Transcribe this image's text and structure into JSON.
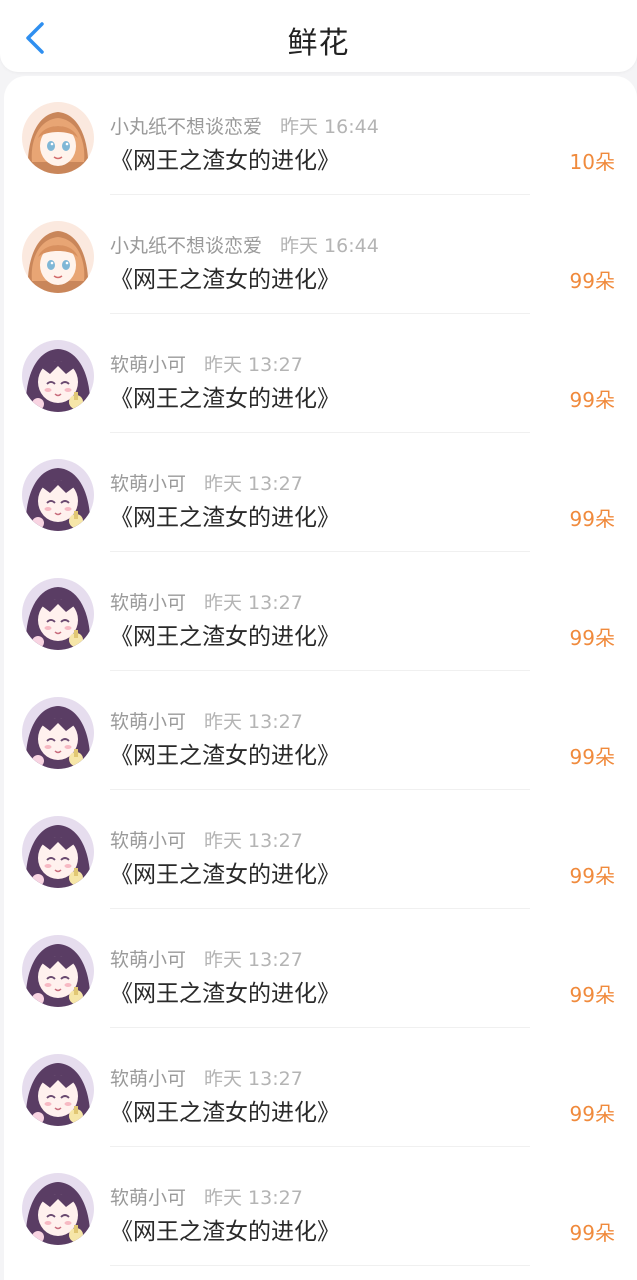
{
  "header": {
    "title": "鲜花",
    "back_icon": "chevron-left-icon",
    "accent_color": "#2f8ff0"
  },
  "colors": {
    "amount": "#f08a3c"
  },
  "items": [
    {
      "avatar": "avatar-girl-orange",
      "name": "小丸纸不想谈恋爱",
      "time": "昨天 16:44",
      "book": "《网王之渣女的进化》",
      "amount": "10朵"
    },
    {
      "avatar": "avatar-girl-orange",
      "name": "小丸纸不想谈恋爱",
      "time": "昨天 16:44",
      "book": "《网王之渣女的进化》",
      "amount": "99朵"
    },
    {
      "avatar": "avatar-girl-purple",
      "name": "软萌小可",
      "time": "昨天 13:27",
      "book": "《网王之渣女的进化》",
      "amount": "99朵"
    },
    {
      "avatar": "avatar-girl-purple",
      "name": "软萌小可",
      "time": "昨天 13:27",
      "book": "《网王之渣女的进化》",
      "amount": "99朵"
    },
    {
      "avatar": "avatar-girl-purple",
      "name": "软萌小可",
      "time": "昨天 13:27",
      "book": "《网王之渣女的进化》",
      "amount": "99朵"
    },
    {
      "avatar": "avatar-girl-purple",
      "name": "软萌小可",
      "time": "昨天 13:27",
      "book": "《网王之渣女的进化》",
      "amount": "99朵"
    },
    {
      "avatar": "avatar-girl-purple",
      "name": "软萌小可",
      "time": "昨天 13:27",
      "book": "《网王之渣女的进化》",
      "amount": "99朵"
    },
    {
      "avatar": "avatar-girl-purple",
      "name": "软萌小可",
      "time": "昨天 13:27",
      "book": "《网王之渣女的进化》",
      "amount": "99朵"
    },
    {
      "avatar": "avatar-girl-purple",
      "name": "软萌小可",
      "time": "昨天 13:27",
      "book": "《网王之渣女的进化》",
      "amount": "99朵"
    },
    {
      "avatar": "avatar-girl-purple",
      "name": "软萌小可",
      "time": "昨天 13:27",
      "book": "《网王之渣女的进化》",
      "amount": "99朵"
    }
  ]
}
